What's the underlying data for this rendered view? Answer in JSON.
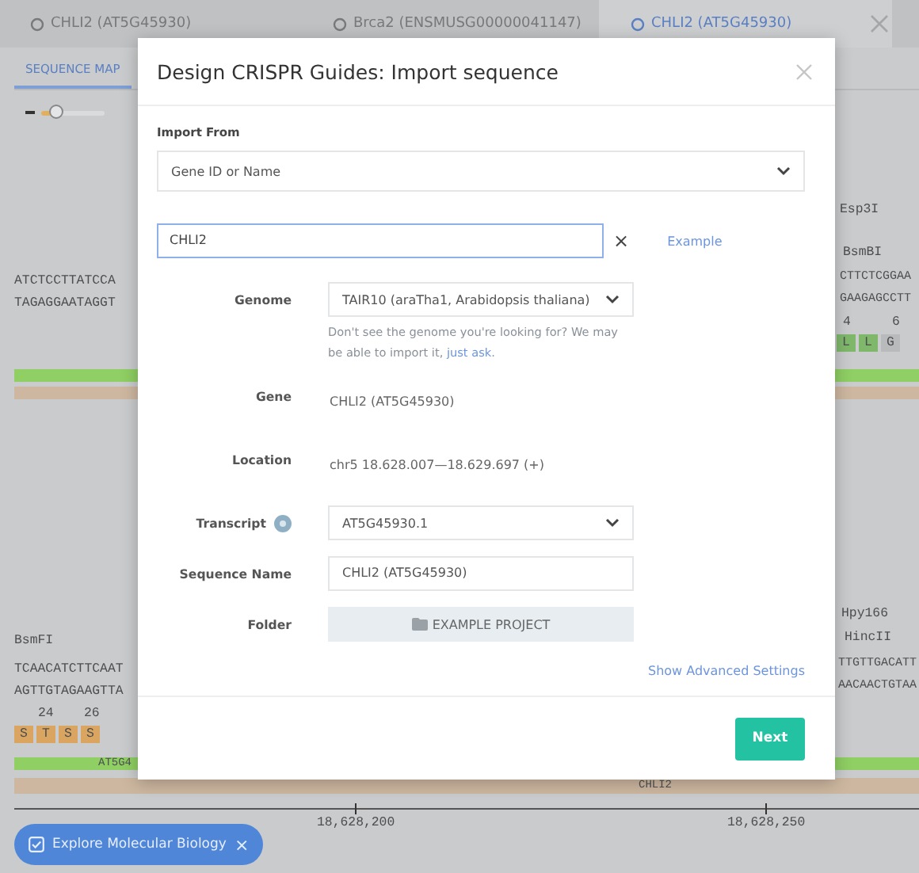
{
  "tabs": [
    {
      "label": "CHLI2 (AT5G45930)",
      "selected": false
    },
    {
      "label": "Brca2 (ENSMUSG00000041147)",
      "selected": false
    },
    {
      "label": "CHLI2 (AT5G45930)",
      "selected": true
    }
  ],
  "view_tabs": [
    {
      "label": "SEQUENCE MAP",
      "selected": true
    }
  ],
  "zoom": {
    "level": 0.25
  },
  "map_items": [
    {
      "kind": "enzyme",
      "text": "Esp3I"
    },
    {
      "kind": "enzyme",
      "text": "BsmBI"
    },
    {
      "kind": "sequence",
      "text": "ATCTCCTTATCCA"
    },
    {
      "kind": "sequence",
      "text": "TAGAGGAATAGGT"
    },
    {
      "kind": "sequence",
      "text": "CTTCTCGGAA"
    },
    {
      "kind": "sequence",
      "text": "GAAGAGCCTT"
    },
    {
      "kind": "number",
      "text": "4"
    },
    {
      "kind": "number",
      "text": "6"
    },
    {
      "kind": "residues",
      "residues": [
        {
          "text": "L",
          "color": "#7fb86b"
        },
        {
          "text": "L",
          "color": "#7fb86b"
        },
        {
          "text": "G",
          "color": "#b8babb"
        }
      ]
    },
    {
      "kind": "feature",
      "color": "#8fcf63"
    },
    {
      "kind": "feature",
      "color": "#cdb7a0"
    },
    {
      "kind": "enzyme",
      "text": "BsmFI"
    },
    {
      "kind": "sequence",
      "text": "TCAACATCTTCAAT"
    },
    {
      "kind": "sequence",
      "text": "AGTTGTAGAAGTTA"
    },
    {
      "kind": "number",
      "text": "24"
    },
    {
      "kind": "number",
      "text": "26"
    },
    {
      "kind": "residues",
      "residues": [
        {
          "text": "S",
          "color": "#d9a560"
        },
        {
          "text": "T",
          "color": "#d9a560"
        },
        {
          "text": "S",
          "color": "#d9a560"
        },
        {
          "text": "S",
          "color": "#d9a560"
        }
      ]
    },
    {
      "kind": "enzyme",
      "text": "Hpy166"
    },
    {
      "kind": "enzyme",
      "text": "HincII"
    },
    {
      "kind": "sequence",
      "text": "TTGTTGACATT"
    },
    {
      "kind": "sequence",
      "text": "AACAACTGTAA"
    },
    {
      "kind": "feature",
      "color": "#8fcf63",
      "text": "AT5G4"
    },
    {
      "kind": "feature",
      "color": "#cdb7a0",
      "text": "CHLI2"
    },
    {
      "kind": "ruler",
      "ticks": [
        "18,628,200",
        "18,628,250"
      ]
    }
  ],
  "banner": {
    "label": "Explore Molecular Biology",
    "close": "×"
  },
  "dialog": {
    "title": "Design CRISPR Guides: Import sequence",
    "import_from": {
      "label": "Import From",
      "value": "Gene ID or Name"
    },
    "query": {
      "value": "CHLI2",
      "clear": "×",
      "example_link": "Example"
    },
    "fields": [
      {
        "kind": "select",
        "label": "Genome",
        "value": "TAIR10 (araTha1, Arabidopsis thaliana)",
        "help": {
          "text": "Don't see the genome you're looking for? We may be able to import it,",
          "link": "just ask",
          "end": "."
        }
      },
      {
        "kind": "text",
        "label": "Gene",
        "value": "CHLI2 (AT5G45930)"
      },
      {
        "kind": "text",
        "label": "Location",
        "value": "chr5 18.628.007—18.629.697 (+)"
      },
      {
        "kind": "select",
        "label": "Transcript",
        "value": "AT5G45930.1",
        "has_help": true
      },
      {
        "kind": "input",
        "label": "Sequence Name",
        "value": "CHLI2 (AT5G45930)"
      },
      {
        "kind": "button",
        "label": "Folder",
        "value": "EXAMPLE PROJECT"
      }
    ],
    "advanced_link": "Show Advanced Settings",
    "next": "Next"
  }
}
